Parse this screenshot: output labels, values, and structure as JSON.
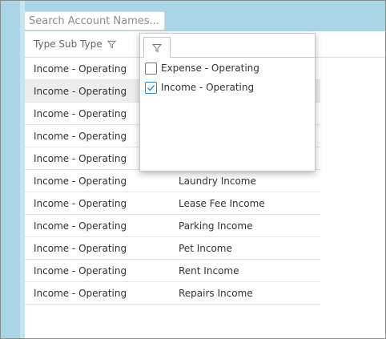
{
  "search": {
    "placeholder": "Search Account Names..."
  },
  "grid": {
    "header": {
      "type_sub_type": "Type Sub Type"
    },
    "rows": [
      {
        "type": "Income - Operating",
        "name": ""
      },
      {
        "type": "Income - Operating",
        "name": ""
      },
      {
        "type": "Income - Operating",
        "name": ""
      },
      {
        "type": "Income - Operating",
        "name": ""
      },
      {
        "type": "Income - Operating",
        "name": ""
      },
      {
        "type": "Income - Operating",
        "name": "Laundry Income"
      },
      {
        "type": "Income - Operating",
        "name": "Lease Fee Income"
      },
      {
        "type": "Income - Operating",
        "name": "Parking Income"
      },
      {
        "type": "Income - Operating",
        "name": "Pet Income"
      },
      {
        "type": "Income - Operating",
        "name": "Rent Income"
      },
      {
        "type": "Income - Operating",
        "name": "Repairs Income"
      }
    ],
    "selected_row_index": 1
  },
  "filter_popup": {
    "tab_icon": "filter-icon",
    "options": [
      {
        "label": "Expense - Operating",
        "checked": false
      },
      {
        "label": "Income - Operating",
        "checked": true
      }
    ]
  },
  "colors": {
    "background_accent": "#a9d5e7",
    "checkbox_checked": "#2e8bc0",
    "selected_row": "#ededed"
  }
}
